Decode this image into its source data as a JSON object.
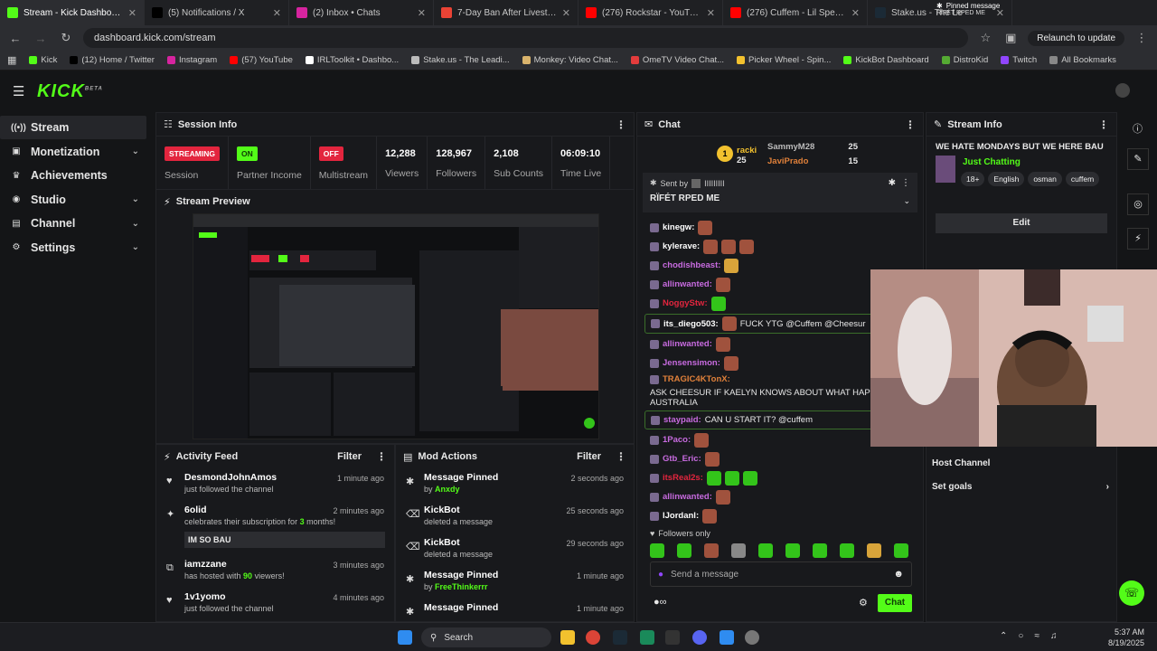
{
  "browser": {
    "tabs": [
      {
        "title": "Stream - Kick Dashboard",
        "color": "#53fc18",
        "active": true
      },
      {
        "title": "(5) Notifications / X",
        "color": "#000000",
        "active": false
      },
      {
        "title": "(2) Inbox • Chats",
        "color": "#d6249f",
        "active": false
      },
      {
        "title": "7-Day Ban After Livestream - c",
        "color": "#ea4335",
        "active": false
      },
      {
        "title": "(276) Rockstar - YouTube",
        "color": "#ff0000",
        "active": false
      },
      {
        "title": "(276) Cuffem - Lil Speed (Offici",
        "color": "#ff0000",
        "active": false
      },
      {
        "title": "Stake.us - The Le",
        "color": "#1b2a36",
        "active": false
      }
    ],
    "url": "dashboard.kick.com/stream",
    "relaunch_label": "Relaunch to update",
    "bookmarks": [
      {
        "label": "Kick",
        "color": "#53fc18"
      },
      {
        "label": "(12) Home / Twitter",
        "color": "#000000"
      },
      {
        "label": "Instagram",
        "color": "#d6249f"
      },
      {
        "label": "(57) YouTube",
        "color": "#ff0000"
      },
      {
        "label": "IRLToolkit • Dashbo...",
        "color": "#ffffff"
      },
      {
        "label": "Stake.us - The Leadi...",
        "color": "#bbbbbb"
      },
      {
        "label": "Monkey: Video Chat...",
        "color": "#d9b36c"
      },
      {
        "label": "OmeTV Video Chat...",
        "color": "#e33c3c"
      },
      {
        "label": "Picker Wheel - Spin...",
        "color": "#f2c12e"
      },
      {
        "label": "KickBot Dashboard",
        "color": "#53fc18"
      },
      {
        "label": "DistroKid",
        "color": "#55aa33"
      },
      {
        "label": "Twitch",
        "color": "#9146ff"
      },
      {
        "label": "All Bookmarks",
        "color": "#888888"
      }
    ]
  },
  "sidebar": {
    "items": [
      {
        "label": "Stream",
        "icon": "signal-icon",
        "chevron": false,
        "active": true
      },
      {
        "label": "Monetization",
        "icon": "money-icon",
        "chevron": true,
        "active": false
      },
      {
        "label": "Achievements",
        "icon": "trophy-icon",
        "chevron": false,
        "active": false
      },
      {
        "label": "Studio",
        "icon": "studio-icon",
        "chevron": true,
        "active": false
      },
      {
        "label": "Channel",
        "icon": "channel-icon",
        "chevron": true,
        "active": false
      },
      {
        "label": "Settings",
        "icon": "gear-icon",
        "chevron": true,
        "active": false
      }
    ]
  },
  "session": {
    "title": "Session Info",
    "stats": [
      {
        "badge": "STREAMING",
        "badge_color": "red",
        "label": "Session"
      },
      {
        "badge": "ON",
        "badge_color": "green",
        "label": "Partner Income"
      },
      {
        "badge": "OFF",
        "badge_color": "red",
        "label": "Multistream"
      },
      {
        "value": "12,288",
        "label": "Viewers"
      },
      {
        "value": "128,967",
        "label": "Followers"
      },
      {
        "value": "2,108",
        "label": "Sub Counts"
      },
      {
        "value": "06:09:10",
        "label": "Time Live"
      }
    ]
  },
  "preview": {
    "title": "Stream Preview"
  },
  "activity": {
    "title": "Activity Feed",
    "filter": "Filter",
    "rows": [
      {
        "icon": "heart-icon",
        "name": "DesmondJohnAmos",
        "sub": "just followed the channel",
        "time": "1 minute ago"
      },
      {
        "icon": "star-icon",
        "name": "6olid",
        "sub_pre": "celebrates their subscription for ",
        "sub_hl": "3",
        "sub_post": " months!",
        "time": "2 minutes ago",
        "message": "IM SO BAU"
      },
      {
        "icon": "host-icon",
        "name": "iamzzane",
        "sub_pre": "has hosted with ",
        "sub_hl": "90",
        "sub_post": " viewers!",
        "time": "3 minutes ago"
      },
      {
        "icon": "heart-icon",
        "name": "1v1yomo",
        "sub": "just followed the channel",
        "time": "4 minutes ago"
      }
    ]
  },
  "mod": {
    "title": "Mod Actions",
    "filter": "Filter",
    "rows": [
      {
        "icon": "pin-icon",
        "name": "Message Pinned",
        "sub_pre": "by ",
        "sub_hl": "Anxdy",
        "time": "2 seconds ago"
      },
      {
        "icon": "trash-icon",
        "name": "KickBot",
        "sub": "deleted a message",
        "time": "25 seconds ago"
      },
      {
        "icon": "trash-icon",
        "name": "KickBot",
        "sub": "deleted a message",
        "time": "29 seconds ago"
      },
      {
        "icon": "pin-icon",
        "name": "Message Pinned",
        "sub_pre": "by ",
        "sub_hl": "FreeThinkerrr",
        "time": "1 minute ago"
      },
      {
        "icon": "pin-icon",
        "name": "Message Pinned",
        "time": "1 minute ago"
      }
    ]
  },
  "chat": {
    "title": "Chat",
    "leaders": [
      {
        "name": "racki",
        "count": "25",
        "color": "#f2c12e"
      },
      {
        "name": "SammyM28",
        "count": "25",
        "color": "#bbbbbb"
      },
      {
        "name": "JaviPrado",
        "count": "15",
        "color": "#e0803a"
      }
    ],
    "leader_rank": "1",
    "pinned_sent_by": "Sent by",
    "pinned_author": "IIIIIIIII",
    "pinned_text": "RÏFÉT RPED ME",
    "messages": [
      {
        "user": "kinegw:",
        "color": "#ffffff",
        "emotes": [
          "r"
        ]
      },
      {
        "user": "kylerave:",
        "color": "#ffffff",
        "emotes": [
          "r",
          "r",
          "r"
        ]
      },
      {
        "user": "chodishbeast:",
        "color": "#c86be0",
        "emotes": [
          "y"
        ]
      },
      {
        "user": "allinwanted:",
        "color": "#c86be0",
        "emotes": [
          "r"
        ]
      },
      {
        "user": "NoggyStw:",
        "color": "#e3253e",
        "emotes": [
          "g"
        ]
      },
      {
        "user": "its_diego503:",
        "color": "#ffffff",
        "text": "FUCK YTG @Cuffem @Cheesur",
        "boxed": true,
        "emotes": [
          "r"
        ]
      },
      {
        "user": "allinwanted:",
        "color": "#c86be0",
        "emotes": [
          "r"
        ]
      },
      {
        "user": "Jensensimon:",
        "color": "#c86be0",
        "emotes": [
          "r"
        ]
      },
      {
        "user": "TRAGIC4KTonX:",
        "color": "#e0803a",
        "text": "ASK CHEESUR IF KAELYN KNOWS ABOUT WHAT HAPPENED IN AUSTRALIA"
      },
      {
        "user": "staypaid:",
        "color": "#c86be0",
        "text": "CAN U START IT? @cuffem",
        "boxed": true
      },
      {
        "user": "1Paco:",
        "color": "#c86be0",
        "emotes": [
          "r"
        ]
      },
      {
        "user": "Gtb_Eric:",
        "color": "#c86be0",
        "emotes": [
          "r"
        ]
      },
      {
        "user": "itsReal2s:",
        "color": "#e3253e",
        "emotes": [
          "g",
          "g",
          "g"
        ]
      },
      {
        "user": "allinwanted:",
        "color": "#c86be0",
        "emotes": [
          "r"
        ]
      },
      {
        "user": "lJordanl:",
        "color": "#ffffff",
        "emotes": [
          "r"
        ]
      }
    ],
    "followers_only": "Followers only",
    "input_placeholder": "Send a message",
    "chat_button": "Chat"
  },
  "stream_info": {
    "title": "Stream Info",
    "stream_title": "WE HATE MONDAYS BUT WE HERE BAU",
    "category": "Just Chatting",
    "tags": [
      "18+",
      "English",
      "osman",
      "cuffem"
    ],
    "edit": "Edit",
    "host_channel": "Host Channel",
    "set_goals": "Set goals",
    "pinned_label": "Pinned message",
    "pinned_author": "RÏFÉT RPED ME"
  },
  "taskbar": {
    "search": "Search",
    "time": "5:37 AM",
    "date": "8/19/2025"
  }
}
